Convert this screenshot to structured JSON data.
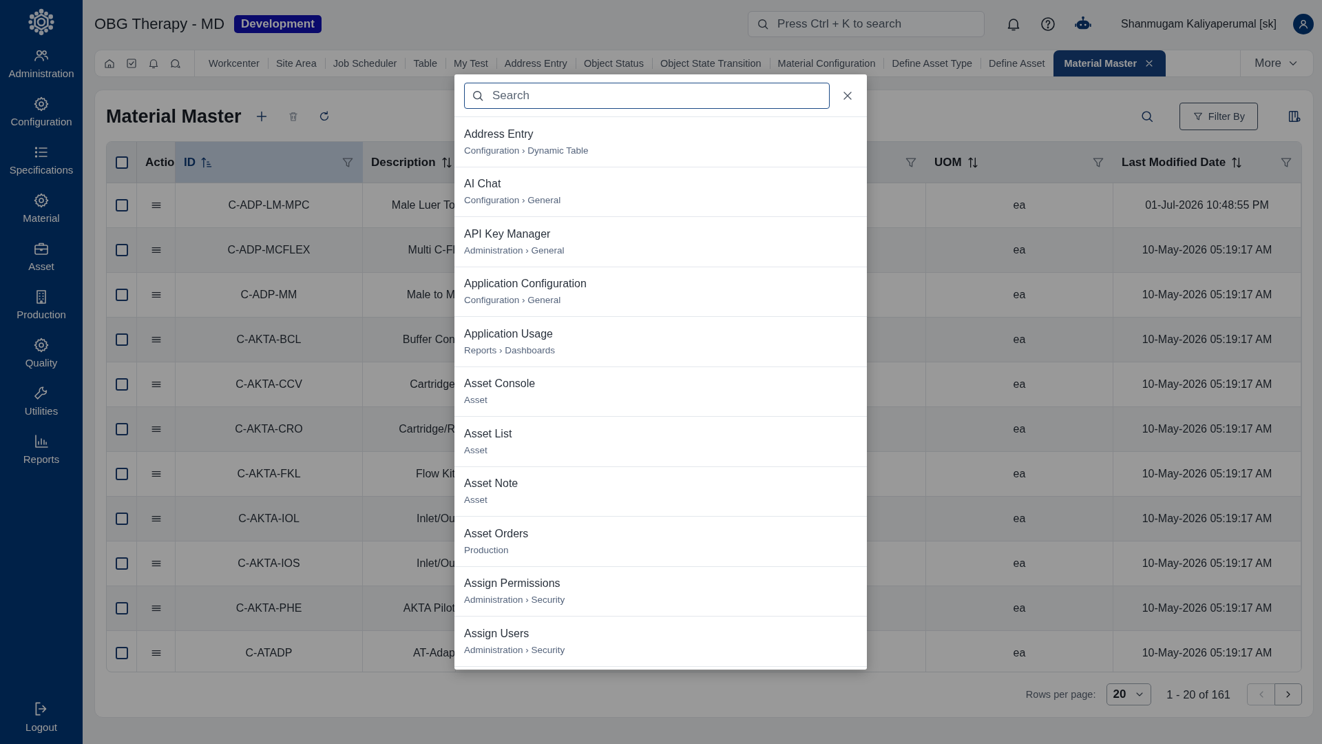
{
  "app": {
    "title": "OBG Therapy - MD",
    "environment": "Development",
    "search_placeholder": "Press Ctrl + K to search",
    "user": "Shanmugam Kaliyaperumal [sk]"
  },
  "sidebar": {
    "items": [
      {
        "label": "Administration"
      },
      {
        "label": "Configuration"
      },
      {
        "label": "Specifications"
      },
      {
        "label": "Material"
      },
      {
        "label": "Asset"
      },
      {
        "label": "Production"
      },
      {
        "label": "Quality"
      },
      {
        "label": "Utilities"
      },
      {
        "label": "Reports"
      }
    ],
    "logout": "Logout"
  },
  "tabs": {
    "items": [
      {
        "label": "Workcenter",
        "selected": false
      },
      {
        "label": "Site Area",
        "selected": false
      },
      {
        "label": "Job Scheduler",
        "selected": false
      },
      {
        "label": "Table",
        "selected": false
      },
      {
        "label": "My Test",
        "selected": false
      },
      {
        "label": "Address Entry",
        "selected": false
      },
      {
        "label": "Object Status",
        "selected": false
      },
      {
        "label": "Object State Transition",
        "selected": false
      },
      {
        "label": "Material Configuration",
        "selected": false
      },
      {
        "label": "Define Asset Type",
        "selected": false
      },
      {
        "label": "Define Asset",
        "selected": false
      },
      {
        "label": "Material Master",
        "selected": true
      }
    ],
    "more": "More"
  },
  "page": {
    "title": "Material Master",
    "filter_button": "Filter By"
  },
  "table": {
    "columns": [
      {
        "kind": "checkbox",
        "checked": false
      },
      {
        "kind": "label",
        "label": "Actio"
      },
      {
        "kind": "sort_filter",
        "label": "ID",
        "sorted": true
      },
      {
        "kind": "sort",
        "label": "Description",
        "sorted": false
      },
      {
        "kind": "filter"
      },
      {
        "kind": "sort_filter",
        "label": "UOM",
        "sorted": false
      },
      {
        "kind": "sort_filter",
        "label": "Last Modified Date",
        "sorted": false
      }
    ],
    "rows": [
      {
        "checked": false,
        "id": "C-ADP-LM-MPC",
        "description": "Male Luer To",
        "uom": "ea",
        "modified": "01-Jul-2026 10:48:55 PM"
      },
      {
        "checked": false,
        "id": "C-ADP-MCFLEX",
        "description": "Multi C-Fl",
        "uom": "ea",
        "modified": "10-May-2026 05:19:17 AM"
      },
      {
        "checked": false,
        "id": "C-ADP-MM",
        "description": "Male to M",
        "uom": "ea",
        "modified": "10-May-2026 05:19:17 AM"
      },
      {
        "checked": false,
        "id": "C-AKTA-BCL",
        "description": "Buffer Con",
        "uom": "ea",
        "modified": "10-May-2026 05:19:17 AM"
      },
      {
        "checked": false,
        "id": "C-AKTA-CCV",
        "description": "Cartridge",
        "uom": "ea",
        "modified": "10-May-2026 05:19:17 AM"
      },
      {
        "checked": false,
        "id": "C-AKTA-CRO",
        "description": "Cartridge/R",
        "uom": "ea",
        "modified": "10-May-2026 05:19:17 AM"
      },
      {
        "checked": false,
        "id": "C-AKTA-FKL",
        "description": "Flow Kit",
        "uom": "ea",
        "modified": "10-May-2026 05:19:17 AM"
      },
      {
        "checked": false,
        "id": "C-AKTA-IOL",
        "description": "Inlet/Ou",
        "uom": "ea",
        "modified": "10-May-2026 05:19:17 AM"
      },
      {
        "checked": false,
        "id": "C-AKTA-IOS",
        "description": "Inlet/Ou",
        "uom": "ea",
        "modified": "10-May-2026 05:19:17 AM"
      },
      {
        "checked": false,
        "id": "C-AKTA-PHE",
        "description": "AKTA Pilot",
        "uom": "ea",
        "modified": "10-May-2026 05:19:17 AM"
      },
      {
        "checked": false,
        "id": "C-ATADP",
        "description": "AT-Adap",
        "uom": "ea",
        "modified": "10-May-2026 05:19:17 AM"
      }
    ]
  },
  "pager": {
    "rows_label": "Rows per page:",
    "rows_value": "20",
    "range": "1 - 20 of 161",
    "prev": {
      "disabled": true
    },
    "next": {
      "disabled": false
    }
  },
  "modal": {
    "search_placeholder": "Search",
    "results": [
      {
        "title": "Address Entry",
        "path": "Configuration › Dynamic Table"
      },
      {
        "title": "AI Chat",
        "path": "Configuration › General"
      },
      {
        "title": "API Key Manager",
        "path": "Administration › General"
      },
      {
        "title": "Application Configuration",
        "path": "Configuration › General"
      },
      {
        "title": "Application Usage",
        "path": "Reports › Dashboards"
      },
      {
        "title": "Asset Console",
        "path": "Asset"
      },
      {
        "title": "Asset List",
        "path": "Asset"
      },
      {
        "title": "Asset Note",
        "path": "Asset"
      },
      {
        "title": "Asset Orders",
        "path": "Production"
      },
      {
        "title": "Assign Permissions",
        "path": "Administration › Security"
      },
      {
        "title": "Assign Users",
        "path": "Administration › Security"
      }
    ]
  }
}
